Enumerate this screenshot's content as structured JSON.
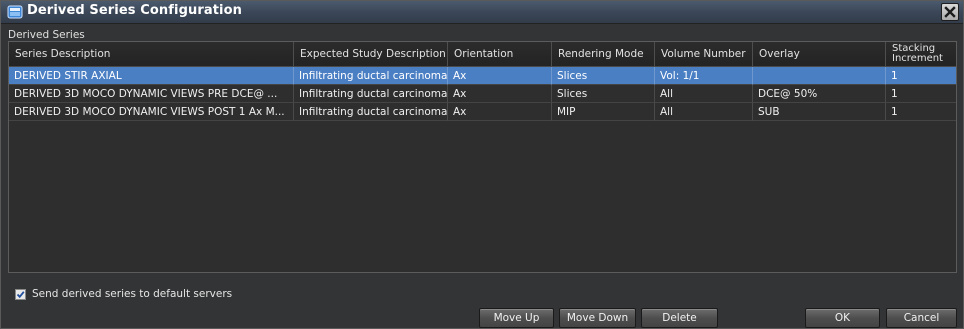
{
  "window": {
    "title": "Derived Series Configuration"
  },
  "section_label": "Derived Series",
  "table": {
    "columns": [
      "Series Description",
      "Expected Study Description",
      "Orientation",
      "Rendering Mode",
      "Volume Number",
      "Overlay",
      "Stacking Increment"
    ],
    "rows": [
      [
        "DERIVED STIR AXIAL",
        "Infiltrating ductal carcinoma,...",
        "Ax",
        "Slices",
        "Vol: 1/1",
        "",
        "1"
      ],
      [
        "DERIVED 3D MOCO DYNAMIC VIEWS PRE DCE@ ...",
        "Infiltrating ductal carcinoma,...",
        "Ax",
        "Slices",
        "All",
        "DCE@ 50%",
        "1"
      ],
      [
        "DERIVED 3D MOCO DYNAMIC VIEWS POST 1 Ax M...",
        "Infiltrating ductal carcinoma,...",
        "Ax",
        "MIP",
        "All",
        "SUB",
        "1"
      ]
    ],
    "selected_row": 0
  },
  "checkbox": {
    "label": "Send derived series to default servers",
    "checked": true
  },
  "buttons": {
    "move_up": "Move Up",
    "move_down": "Move Down",
    "delete": "Delete",
    "ok": "OK",
    "cancel": "Cancel"
  },
  "colors": {
    "selection": "#4b7fc4",
    "background": "#333435",
    "title_bar": "#3a4657"
  }
}
